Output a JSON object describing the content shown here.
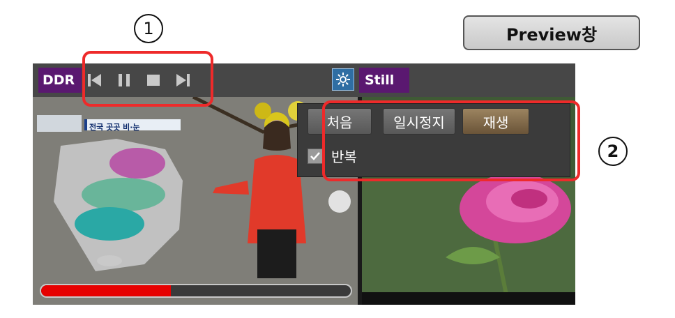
{
  "callouts": {
    "one": "1",
    "two": "2"
  },
  "preview_label": "Preview창",
  "toolbar": {
    "ddr_label": "DDR",
    "still_label": "Still",
    "transport_icons": [
      "skip-back-icon",
      "pause-icon",
      "stop-icon",
      "skip-forward-icon"
    ],
    "settings_icon": "gear-icon"
  },
  "menu": {
    "first_label": "처음",
    "pause_label": "일시정지",
    "play_label": "재생",
    "repeat_label": "반복",
    "repeat_checked": true
  },
  "video": {
    "caption_text": "전국 곳곳 비·눈",
    "progress_fraction": 0.42
  },
  "colors": {
    "highlight": "#ee2a2a",
    "label_bg": "#5a1870",
    "progress": "#e60000"
  }
}
